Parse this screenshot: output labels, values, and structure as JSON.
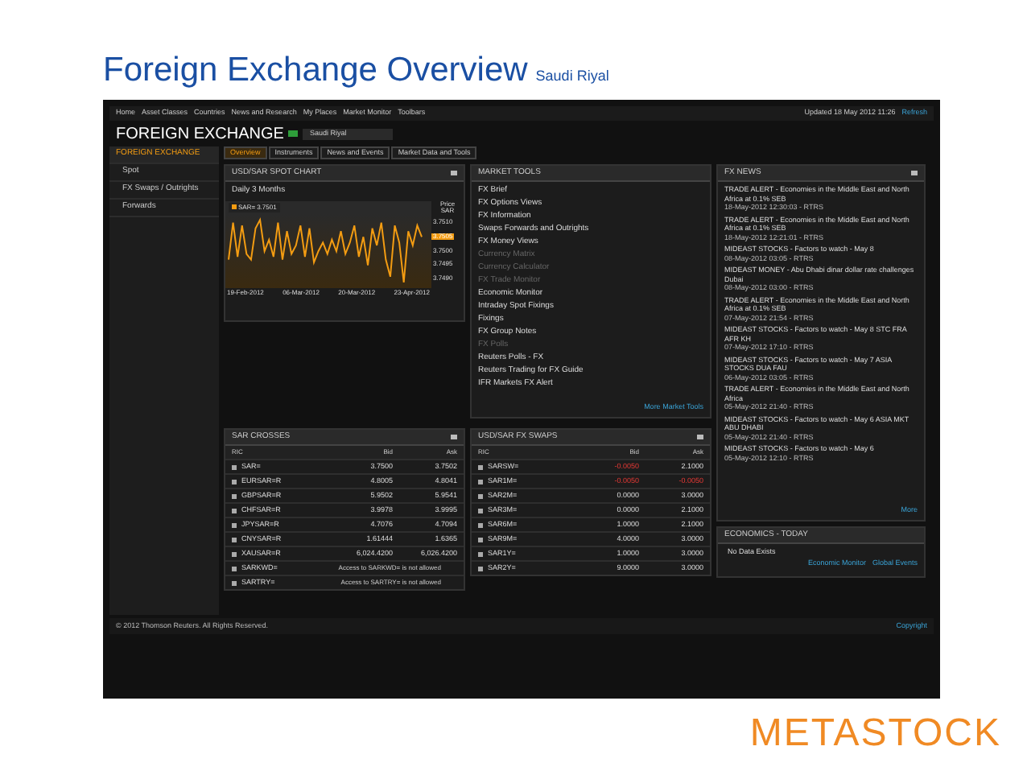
{
  "slide": {
    "title": "Foreign Exchange Overview",
    "subtitle": "Saudi Riyal",
    "logo": "METASTOCK"
  },
  "nav": {
    "items": [
      "Home",
      "Asset Classes",
      "Countries",
      "News and Research",
      "My Places",
      "Market Monitor",
      "Toolbars"
    ],
    "updated": "Updated 18 May 2012 11:26",
    "refresh": "Refresh"
  },
  "header": {
    "title": "FOREIGN EXCHANGE",
    "select": "Saudi Riyal"
  },
  "sidebar": {
    "items": [
      {
        "label": "FOREIGN EXCHANGE",
        "selected": true
      },
      {
        "label": "Spot",
        "selected": false
      },
      {
        "label": "FX Swaps / Outrights",
        "selected": false
      },
      {
        "label": "Forwards",
        "selected": false
      }
    ]
  },
  "tabs": [
    {
      "label": "Overview",
      "selected": true
    },
    {
      "label": "Instruments",
      "selected": false
    },
    {
      "label": "News and Events",
      "selected": false
    },
    {
      "label": "Market Data and Tools",
      "selected": false
    }
  ],
  "spot_chart": {
    "title": "USD/SAR SPOT CHART",
    "period": "Daily 3 Months",
    "legend": "3.7501",
    "axis_title": [
      "Price",
      "SAR"
    ],
    "current_value": "3.7505",
    "x_labels": [
      "19-Feb-2012",
      "06-Mar-2012",
      "20-Mar-2012",
      "23-Apr-2012"
    ],
    "chart_data": {
      "type": "line",
      "ylim": [
        3.7487,
        3.7513
      ],
      "yticks": [
        {
          "value": 3.751,
          "label": "3.7510"
        },
        {
          "value": 3.75,
          "label": "3.7500"
        },
        {
          "value": 3.7495,
          "label": "3.7495"
        },
        {
          "value": 3.749,
          "label": "3.7490"
        }
      ],
      "series": [
        {
          "name": "SAR=",
          "color": "#f39c12",
          "values": [
            3.7497,
            3.751,
            3.7498,
            3.7509,
            3.7499,
            3.7497,
            3.7508,
            3.7511,
            3.75,
            3.7504,
            3.7498,
            3.751,
            3.7497,
            3.7507,
            3.7499,
            3.7502,
            3.7509,
            3.7498,
            3.7508,
            3.7496,
            3.75,
            3.7503,
            3.7499,
            3.7504,
            3.75,
            3.7507,
            3.7499,
            3.7503,
            3.7509,
            3.7498,
            3.7505,
            3.7495,
            3.7508,
            3.7502,
            3.751,
            3.7497,
            3.7491,
            3.7509,
            3.7503,
            3.7489,
            3.7507,
            3.7502,
            3.7509,
            3.7505
          ]
        }
      ]
    }
  },
  "market_tools": {
    "title": "MARKET TOOLS",
    "items": [
      {
        "label": "FX Brief",
        "disabled": false
      },
      {
        "label": "FX Options Views",
        "disabled": false
      },
      {
        "label": "FX Information",
        "disabled": false
      },
      {
        "label": "Swaps Forwards and Outrights",
        "disabled": false
      },
      {
        "label": "FX Money Views",
        "disabled": false
      },
      {
        "label": "Currency Matrix",
        "disabled": true
      },
      {
        "label": "Currency Calculator",
        "disabled": true
      },
      {
        "label": "FX Trade Monitor",
        "disabled": true
      },
      {
        "label": "Economic Monitor",
        "disabled": false
      },
      {
        "label": "Intraday Spot Fixings",
        "disabled": false
      },
      {
        "label": "Fixings",
        "disabled": false
      },
      {
        "label": "FX Group Notes",
        "disabled": false
      },
      {
        "label": "FX Polls",
        "disabled": true
      },
      {
        "label": "Reuters Polls - FX",
        "disabled": false
      },
      {
        "label": "Reuters Trading for FX Guide",
        "disabled": false
      },
      {
        "label": "IFR Markets FX Alert",
        "disabled": false
      }
    ],
    "more": "More Market Tools"
  },
  "fx_news": {
    "title": "FX NEWS",
    "items": [
      {
        "headline": "TRADE ALERT - Economies in the Middle East and North Africa at 0.1% SEB",
        "meta": "18-May-2012 12:30:03 - RTRS"
      },
      {
        "headline": "TRADE ALERT - Economies in the Middle East and North Africa at 0.1% SEB",
        "meta": "18-May-2012 12:21:01 - RTRS"
      },
      {
        "headline": "MIDEAST STOCKS - Factors to watch - May 8",
        "meta": "08-May-2012 03:05 - RTRS"
      },
      {
        "headline": "MIDEAST MONEY - Abu Dhabi dinar dollar rate challenges Dubai",
        "meta": "08-May-2012 03:00 - RTRS"
      },
      {
        "headline": "TRADE ALERT - Economies in the Middle East and North Africa at 0.1% SEB",
        "meta": "07-May-2012 21:54 - RTRS"
      },
      {
        "headline": "MIDEAST STOCKS - Factors to watch - May 8 STC FRA AFR KH",
        "meta": "07-May-2012 17:10 - RTRS"
      },
      {
        "headline": "MIDEAST STOCKS - Factors to watch - May 7 ASIA STOCKS DUA FAU",
        "meta": "06-May-2012 03:05 - RTRS"
      },
      {
        "headline": "TRADE ALERT - Economies in the Middle East and North Africa",
        "meta": "05-May-2012 21:40 - RTRS"
      },
      {
        "headline": "MIDEAST STOCKS - Factors to watch - May 6 ASIA MKT ABU DHABI",
        "meta": "05-May-2012 21:40 - RTRS"
      },
      {
        "headline": "MIDEAST STOCKS - Factors to watch - May 6",
        "meta": "05-May-2012 12:10 - RTRS"
      }
    ],
    "more": "More"
  },
  "sar_crosses": {
    "title": "SAR CROSSES",
    "columns": [
      "RIC",
      "Bid",
      "Ask"
    ],
    "rows": [
      {
        "ric": "SAR=",
        "bid": "3.7500",
        "ask": "3.7502"
      },
      {
        "ric": "EURSAR=R",
        "bid": "4.8005",
        "ask": "4.8041"
      },
      {
        "ric": "GBPSAR=R",
        "bid": "5.9502",
        "ask": "5.9541"
      },
      {
        "ric": "CHFSAR=R",
        "bid": "3.9978",
        "ask": "3.9995"
      },
      {
        "ric": "JPYSAR=R",
        "bid": "4.7076",
        "ask": "4.7094"
      },
      {
        "ric": "CNYSAR=R",
        "bid": "1.61444",
        "ask": "1.6365"
      },
      {
        "ric": "XAUSAR=R",
        "bid": "6,024.4200",
        "ask": "6,026.4200"
      },
      {
        "ric": "SARKWD=",
        "note": "Access to SARKWD= is not allowed"
      },
      {
        "ric": "SARTRY=",
        "note": "Access to SARTRY= is not allowed"
      }
    ]
  },
  "swaps": {
    "title": "USD/SAR FX SWAPS",
    "columns": [
      "RIC",
      "Bid",
      "Ask"
    ],
    "rows": [
      {
        "ric": "SARSW=",
        "bid": {
          "value": "-0.0050",
          "down": true
        },
        "ask": {
          "value": "2.1000",
          "down": false
        }
      },
      {
        "ric": "SAR1M=",
        "bid": {
          "value": "-0.0050",
          "down": true
        },
        "ask": {
          "value": "-0.0050",
          "down": true
        }
      },
      {
        "ric": "SAR2M=",
        "bid": {
          "value": "0.0000",
          "down": false
        },
        "ask": {
          "value": "3.0000",
          "down": false
        }
      },
      {
        "ric": "SAR3M=",
        "bid": {
          "value": "0.0000",
          "down": false
        },
        "ask": {
          "value": "2.1000",
          "down": false
        }
      },
      {
        "ric": "SAR6M=",
        "bid": {
          "value": "1.0000",
          "down": false
        },
        "ask": {
          "value": "2.1000",
          "down": false
        }
      },
      {
        "ric": "SAR9M=",
        "bid": {
          "value": "4.0000",
          "down": false
        },
        "ask": {
          "value": "3.0000",
          "down": false
        }
      },
      {
        "ric": "SAR1Y=",
        "bid": {
          "value": "1.0000",
          "down": false
        },
        "ask": {
          "value": "3.0000",
          "down": false
        }
      },
      {
        "ric": "SAR2Y=",
        "bid": {
          "value": "9.0000",
          "down": false
        },
        "ask": {
          "value": "3.0000",
          "down": false
        }
      }
    ]
  },
  "economics": {
    "title": "ECONOMICS - TODAY",
    "message": "No Data Exists",
    "links": [
      "Economic Monitor",
      "Global Events"
    ]
  },
  "footer": {
    "copyright": "© 2012 Thomson Reuters. All Rights Reserved.",
    "link": "Copyright"
  }
}
